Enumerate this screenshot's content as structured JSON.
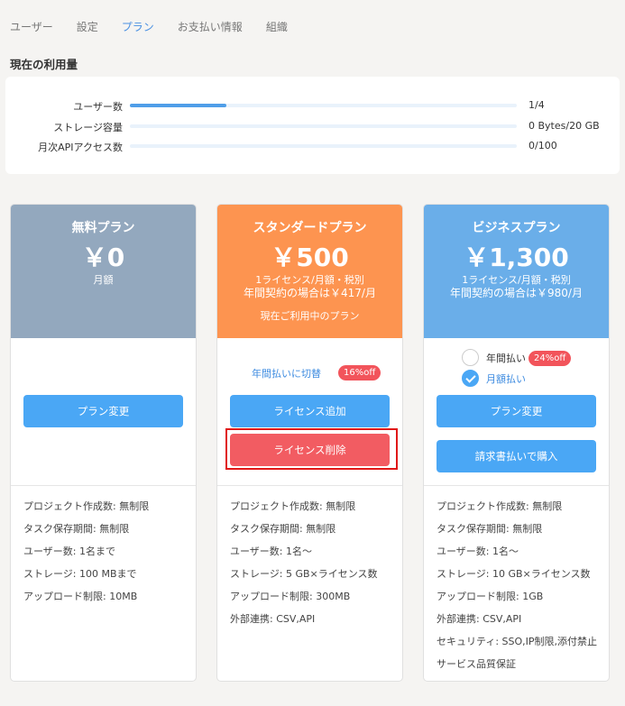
{
  "tabs": [
    "ユーザー",
    "設定",
    "プラン",
    "お支払い情報",
    "組織"
  ],
  "section_title": "現在の利用量",
  "usage": [
    {
      "label": "ユーザー数",
      "value": "1/4",
      "fraction": 0.25
    },
    {
      "label": "ストレージ容量",
      "value": "0 Bytes/20 GB",
      "fraction": 0
    },
    {
      "label": "月次APIアクセス数",
      "value": "0/100",
      "fraction": 0
    }
  ],
  "colors": {
    "free": "#93a8be",
    "standard": "#fd9450",
    "business": "#6aaee9",
    "accent": "#4aa7f5",
    "danger": "#f25c62"
  },
  "plans": {
    "free": {
      "name": "無料プラン",
      "price": "￥0",
      "sub": "月額",
      "button": "プラン変更",
      "features": [
        "プロジェクト作成数: 無制限",
        "タスク保存期間: 無制限",
        "ユーザー数: 1名まで",
        "ストレージ: 100 MBまで",
        "アップロード制限: 10MB"
      ]
    },
    "standard": {
      "name": "スタンダードプラン",
      "price": "￥500",
      "sub1": "1ライセンス/月額・税別",
      "sub2": "年間契約の場合は￥417/月",
      "current": "現在ご利用中のプラン",
      "switch_link": "年間払いに切替",
      "badge": "16%off",
      "add_button": "ライセンス追加",
      "remove_button": "ライセンス削除",
      "features": [
        "プロジェクト作成数: 無制限",
        "タスク保存期間: 無制限",
        "ユーザー数: 1名～",
        "ストレージ: 5 GB×ライセンス数",
        "アップロード制限: 300MB",
        "外部連携: CSV,API"
      ]
    },
    "business": {
      "name": "ビジネスプラン",
      "price": "￥1,300",
      "sub1": "1ライセンス/月額・税別",
      "sub2": "年間契約の場合は￥980/月",
      "annual": "年間払い",
      "badge": "24%off",
      "monthly": "月額払い",
      "button": "プラン変更",
      "invoice_button": "請求書払いで購入",
      "features": [
        "プロジェクト作成数: 無制限",
        "タスク保存期間: 無制限",
        "ユーザー数: 1名～",
        "ストレージ: 10 GB×ライセンス数",
        "アップロード制限: 1GB",
        "外部連携: CSV,API",
        "セキュリティ: SSO,IP制限,添付禁止",
        "サービス品質保証"
      ]
    }
  }
}
